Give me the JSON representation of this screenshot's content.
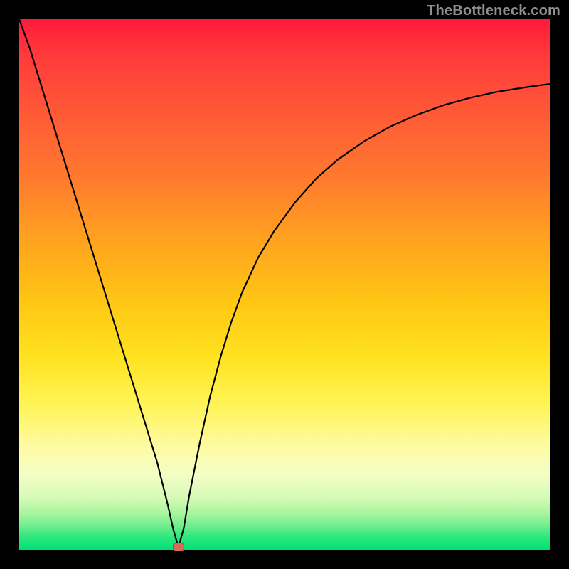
{
  "watermark": "TheBottleneck.com",
  "chart_data": {
    "type": "line",
    "title": "",
    "xlabel": "",
    "ylabel": "",
    "xlim": [
      0,
      100
    ],
    "ylim": [
      0,
      100
    ],
    "grid": false,
    "series": [
      {
        "name": "curve",
        "x": [
          0,
          2,
          4,
          6,
          8,
          10,
          12,
          14,
          16,
          18,
          20,
          22,
          24,
          26,
          28,
          29,
          30,
          31,
          32,
          34,
          36,
          38,
          40,
          42,
          45,
          48,
          52,
          56,
          60,
          65,
          70,
          75,
          80,
          85,
          90,
          95,
          100
        ],
        "y": [
          100,
          94.5,
          88.0,
          81.5,
          75.0,
          68.5,
          62.0,
          55.5,
          49.0,
          42.5,
          36.0,
          29.5,
          23.0,
          16.5,
          8.5,
          4.0,
          0.5,
          4.0,
          10.0,
          20.0,
          29.0,
          36.5,
          43.0,
          48.5,
          55.0,
          60.0,
          65.5,
          70.0,
          73.5,
          77.0,
          79.8,
          82.0,
          83.8,
          85.2,
          86.3,
          87.1,
          87.8
        ]
      }
    ],
    "annotations": [
      {
        "name": "marker",
        "x": 30,
        "y": 0.5,
        "shape": "red-oval"
      }
    ],
    "background_gradient": {
      "orientation": "top-to-bottom",
      "stops": [
        {
          "pos": 0,
          "color": "#ff1a3a"
        },
        {
          "pos": 30,
          "color": "#ff7a2e"
        },
        {
          "pos": 55,
          "color": "#ffc814"
        },
        {
          "pos": 80,
          "color": "#fdfba6"
        },
        {
          "pos": 95,
          "color": "#6fee8e"
        },
        {
          "pos": 100,
          "color": "#00df75"
        }
      ]
    }
  }
}
